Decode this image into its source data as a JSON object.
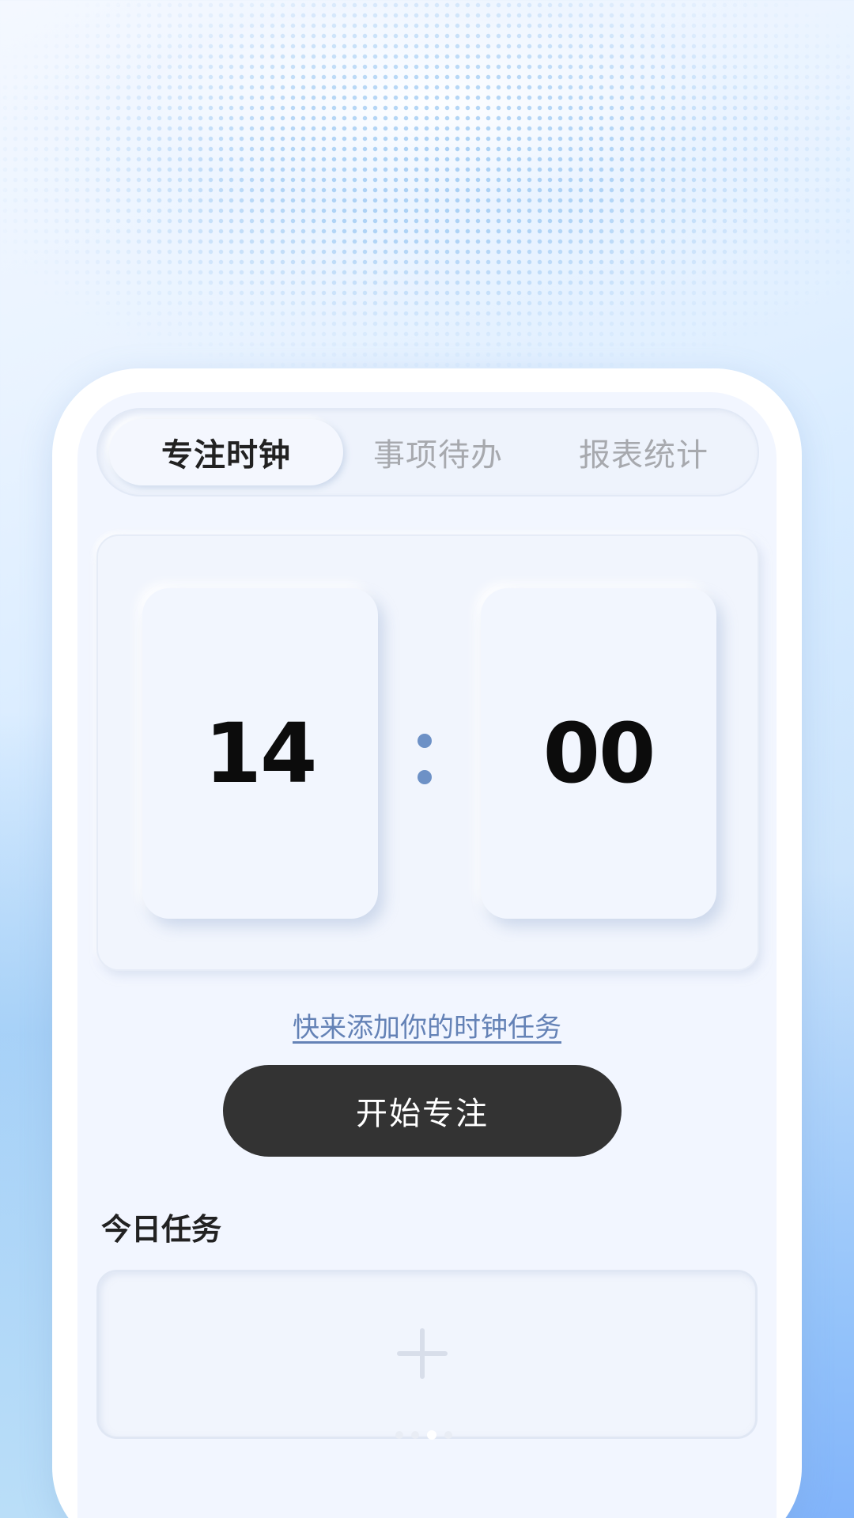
{
  "tabs": [
    {
      "label": "专注时钟",
      "active": true
    },
    {
      "label": "事项待办",
      "active": false
    },
    {
      "label": "报表统计",
      "active": false
    }
  ],
  "clock": {
    "hours": "14",
    "minutes": "00"
  },
  "add_task_link": "快来添加你的时钟任务",
  "start_button": "开始专注",
  "today_tasks": {
    "title": "今日任务",
    "add_icon": "plus-icon"
  },
  "colors": {
    "accent": "#6d91c6",
    "button_bg": "#333333",
    "link": "#6482b6"
  }
}
